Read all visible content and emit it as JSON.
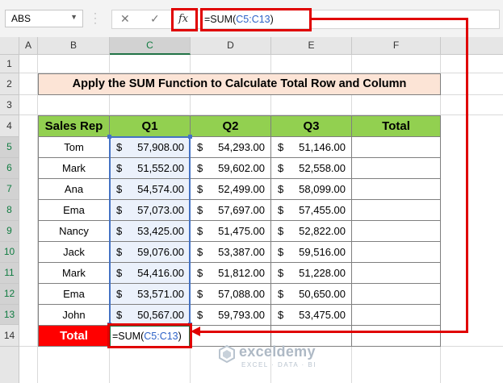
{
  "formula_bar": {
    "name_box": "ABS",
    "cancel_glyph": "✕",
    "enter_glyph": "✓",
    "fx_label": "fx",
    "formula_prefix": "=SUM(",
    "formula_ref": "C5:C13",
    "formula_suffix": ")"
  },
  "columns": [
    "A",
    "B",
    "C",
    "D",
    "E",
    "F"
  ],
  "rows": [
    "1",
    "2",
    "3",
    "4",
    "5",
    "6",
    "7",
    "8",
    "9",
    "10",
    "11",
    "12",
    "13",
    "14"
  ],
  "title": "Apply the SUM Function to Calculate Total Row and Column",
  "table": {
    "headers": [
      "Sales Rep",
      "Q1",
      "Q2",
      "Q3",
      "Total"
    ],
    "currency": "$",
    "rows": [
      {
        "name": "Tom",
        "q1": "57,908.00",
        "q2": "54,293.00",
        "q3": "51,146.00"
      },
      {
        "name": "Mark",
        "q1": "51,552.00",
        "q2": "59,602.00",
        "q3": "52,558.00"
      },
      {
        "name": "Ana",
        "q1": "54,574.00",
        "q2": "52,499.00",
        "q3": "58,099.00"
      },
      {
        "name": "Ema",
        "q1": "57,073.00",
        "q2": "57,697.00",
        "q3": "57,455.00"
      },
      {
        "name": "Nancy",
        "q1": "53,425.00",
        "q2": "51,475.00",
        "q3": "52,822.00"
      },
      {
        "name": "Jack",
        "q1": "59,076.00",
        "q2": "53,387.00",
        "q3": "59,516.00"
      },
      {
        "name": "Mark",
        "q1": "54,416.00",
        "q2": "51,812.00",
        "q3": "51,228.00"
      },
      {
        "name": "Ema",
        "q1": "53,571.00",
        "q2": "57,088.00",
        "q3": "50,650.00"
      },
      {
        "name": "John",
        "q1": "50,567.00",
        "q2": "59,793.00",
        "q3": "53,475.00"
      }
    ],
    "total_label": "Total",
    "active_cell_prefix": "=SUM(",
    "active_cell_ref": "C5:C13",
    "active_cell_suffix": ")"
  },
  "watermark": {
    "name": "exceldemy",
    "tagline": "EXCEL · DATA · BI"
  },
  "colors": {
    "header_green": "#92d050",
    "title_fill": "#fce4d6",
    "total_red": "#ff0000",
    "annotation_red": "#e00000",
    "selection_blue": "#4472c4"
  }
}
